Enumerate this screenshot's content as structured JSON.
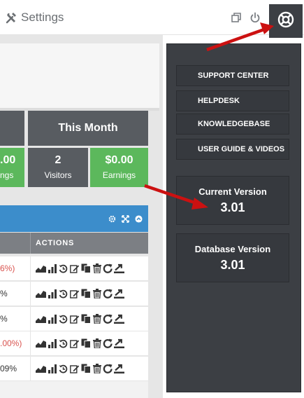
{
  "header": {
    "title": "Settings"
  },
  "stats": {
    "this_month": "This Month",
    "cut_value": ".00",
    "cut_label": "ngs",
    "visitors_value": "2",
    "visitors_label": "Visitors",
    "earnings_value": "$0.00",
    "earnings_label": "Earnings"
  },
  "table": {
    "actions_header": "ACTIONS",
    "rows": [
      {
        "pct": "6%)",
        "red": true
      },
      {
        "pct": "%",
        "red": false
      },
      {
        "pct": "%",
        "red": false
      },
      {
        "pct": ".00%)",
        "red": true
      },
      {
        "pct": "09%",
        "red": false
      }
    ]
  },
  "dropdown": {
    "items": [
      "SUPPORT CENTER",
      "HELPDESK",
      "KNOWLEDGEBASE",
      "USER GUIDE & VIDEOS"
    ],
    "current_version_label": "Current Version",
    "current_version": "3.01",
    "database_version_label": "Database Version",
    "database_version": "3.01"
  },
  "colors": {
    "dark_panel": "#3c3f44",
    "stat_header": "#585c61",
    "green": "#5cb85c",
    "blue": "#3c8dcb",
    "red_arrow": "#cc1111"
  },
  "icons": {
    "brand": "tools-icon",
    "window": "restore-window-icon",
    "power": "power-icon",
    "help": "lifebuoy-icon",
    "row_actions": [
      "area-chart-icon",
      "bar-chart-icon",
      "history-icon",
      "edit-icon",
      "copy-icon",
      "trash-icon",
      "refresh-icon",
      "export-icon"
    ]
  }
}
